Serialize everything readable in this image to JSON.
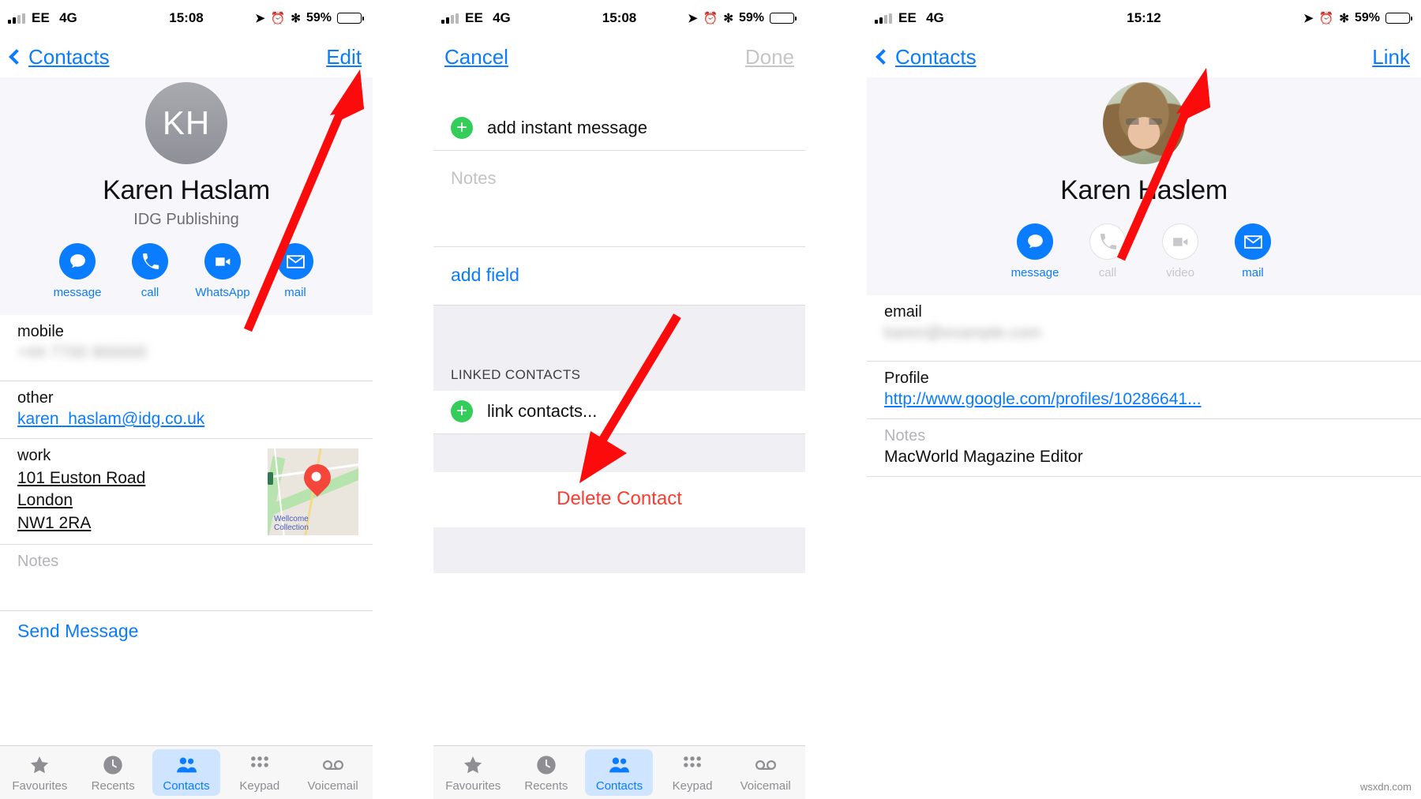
{
  "watermark": "wsxdn.com",
  "panels": [
    {
      "id": "contact-view",
      "status": {
        "carrier": "EE",
        "network": "4G",
        "time": "15:08",
        "battery_pct": "59%"
      },
      "nav": {
        "back_label": "Contacts",
        "action_label": "Edit"
      },
      "contact": {
        "initials": "KH",
        "name": "Karen Haslam",
        "org": "IDG Publishing"
      },
      "actions": [
        {
          "label": "message",
          "icon": "message-icon",
          "enabled": true
        },
        {
          "label": "call",
          "icon": "phone-icon",
          "enabled": true
        },
        {
          "label": "WhatsApp",
          "icon": "video-icon",
          "enabled": true
        },
        {
          "label": "mail",
          "icon": "mail-icon",
          "enabled": true
        }
      ],
      "fields": [
        {
          "label": "mobile",
          "value": "",
          "kind": "blurred"
        },
        {
          "label": "other",
          "value": "karen_haslam@idg.co.uk",
          "kind": "link"
        },
        {
          "label": "work",
          "value": "101 Euston Road\nLondon\nNW1 2RA",
          "kind": "address"
        },
        {
          "label": "Notes",
          "value": "",
          "kind": "placeholder"
        }
      ],
      "map_label": "Wellcome\nCollection",
      "footer_link": "Send Message",
      "tabs": [
        {
          "label": "Favourites",
          "icon": "star-icon",
          "active": false
        },
        {
          "label": "Recents",
          "icon": "clock-icon",
          "active": false
        },
        {
          "label": "Contacts",
          "icon": "people-icon",
          "active": true
        },
        {
          "label": "Keypad",
          "icon": "keypad-icon",
          "active": false
        },
        {
          "label": "Voicemail",
          "icon": "voicemail-icon",
          "active": false
        }
      ]
    },
    {
      "id": "edit-contact",
      "status": {
        "carrier": "EE",
        "network": "4G",
        "time": "15:08",
        "battery_pct": "59%"
      },
      "nav": {
        "back_label": "Cancel",
        "action_label": "Done",
        "action_disabled": true
      },
      "add_instant_message": "add instant message",
      "notes_placeholder": "Notes",
      "add_field": "add field",
      "linked_section_header": "LINKED CONTACTS",
      "link_contacts": "link contacts...",
      "delete_contact": "Delete Contact",
      "tabs": [
        {
          "label": "Favourites",
          "icon": "star-icon",
          "active": false
        },
        {
          "label": "Recents",
          "icon": "clock-icon",
          "active": false
        },
        {
          "label": "Contacts",
          "icon": "people-icon",
          "active": true
        },
        {
          "label": "Keypad",
          "icon": "keypad-icon",
          "active": false
        },
        {
          "label": "Voicemail",
          "icon": "voicemail-icon",
          "active": false
        }
      ]
    },
    {
      "id": "linked-contact-view",
      "status": {
        "carrier": "EE",
        "network": "4G",
        "time": "15:12",
        "battery_pct": "59%"
      },
      "nav": {
        "back_label": "Contacts",
        "action_label": "Link"
      },
      "contact": {
        "name": "Karen Haslem",
        "photo": "contact-photo"
      },
      "actions": [
        {
          "label": "message",
          "icon": "message-icon",
          "enabled": true
        },
        {
          "label": "call",
          "icon": "phone-icon",
          "enabled": false
        },
        {
          "label": "video",
          "icon": "video-icon",
          "enabled": false
        },
        {
          "label": "mail",
          "icon": "mail-icon",
          "enabled": true
        }
      ],
      "fields": [
        {
          "label": "email",
          "value": "",
          "kind": "blurred"
        },
        {
          "label": "Profile",
          "value": "http://www.google.com/profiles/10286641...",
          "kind": "link"
        },
        {
          "label": "Notes",
          "value": "MacWorld Magazine Editor",
          "kind": "notes"
        }
      ]
    }
  ]
}
